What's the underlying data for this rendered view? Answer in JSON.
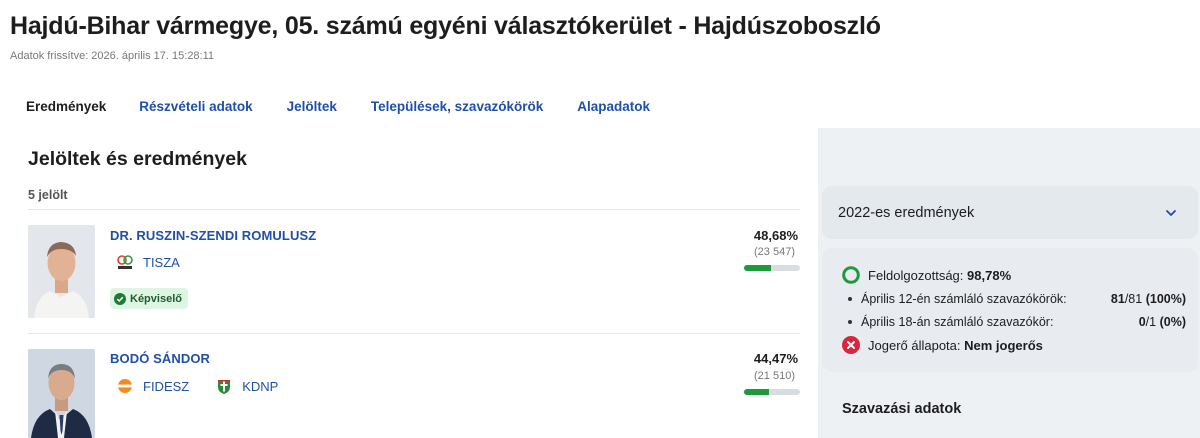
{
  "header": {
    "title": "Hajdú-Bihar vármegye, 05. számú egyéni választókerület - Hajdúszoboszló",
    "updated": "Adatok frissítve: 2026. április 17. 15:28:11"
  },
  "tabs": [
    {
      "label": "Eredmények",
      "active": true
    },
    {
      "label": "Részvételi adatok"
    },
    {
      "label": "Jelöltek"
    },
    {
      "label": "Települések, szavazókörök"
    },
    {
      "label": "Alapadatok"
    }
  ],
  "main": {
    "title": "Jelöltek és eredmények",
    "count": "5 jelölt",
    "candidates": [
      {
        "name": "DR. RUSZIN-SZENDI ROMULUSZ",
        "parties": [
          {
            "name": "TISZA",
            "icon": "tisza-logo-icon"
          }
        ],
        "badge": "Képviselő",
        "percent": "48,68%",
        "votes": "(23 547)",
        "share": 0.4868
      },
      {
        "name": "BODÓ SÁNDOR",
        "parties": [
          {
            "name": "FIDESZ",
            "icon": "fidesz-logo-icon"
          },
          {
            "name": "KDNP",
            "icon": "kdnp-logo-icon"
          }
        ],
        "percent": "44,47%",
        "votes": "(21 510)",
        "share": 0.4447
      }
    ]
  },
  "side": {
    "results2022": "2022-es eredmények",
    "status": {
      "processed_label": "Feldolgozottság:",
      "processed_value": "98,78%",
      "apr12_label": "Április 12-én számláló szavazókörök:",
      "apr12_done": "81",
      "apr12_rest": "/81",
      "apr12_pct": "(100%)",
      "apr18_label": "Április 18-án számláló szavazókör:",
      "apr18_done": "0",
      "apr18_rest": "/1",
      "apr18_pct": "(0%)",
      "final_label": "Jogerő állapota:",
      "final_value": "Nem jogerős"
    },
    "voting_title": "Szavazási adatok"
  },
  "colors": {
    "link": "#1f4fa8",
    "bar_fill": "#1e9a3d",
    "ok": "#1e9a3d",
    "error": "#d9263a"
  }
}
